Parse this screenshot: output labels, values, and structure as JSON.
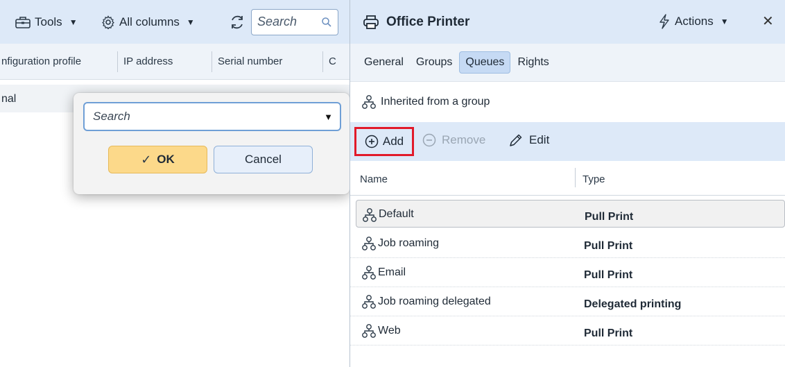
{
  "left": {
    "toolbar": {
      "tools_label": "Tools",
      "columns_label": "All columns",
      "search_placeholder": "Search"
    },
    "columns": [
      "nfiguration profile",
      "IP address",
      "Serial number",
      "C"
    ],
    "row_text": "nal"
  },
  "dialog": {
    "search_placeholder": "Search",
    "ok_label": "OK",
    "cancel_label": "Cancel"
  },
  "right": {
    "title": "Office Printer",
    "actions_label": "Actions",
    "tabs": [
      "General",
      "Groups",
      "Queues",
      "Rights"
    ],
    "active_tab": "Queues",
    "inherited_label": "Inherited from a group",
    "toolbar": {
      "add_label": "Add",
      "remove_label": "Remove",
      "edit_label": "Edit"
    },
    "grid": {
      "headers": [
        "Name",
        "Type"
      ],
      "rows": [
        {
          "name": "Default",
          "type": "Pull Print"
        },
        {
          "name": "Job roaming",
          "type": "Pull Print"
        },
        {
          "name": "Email",
          "type": "Pull Print"
        },
        {
          "name": "Job roaming delegated",
          "type": "Delegated printing"
        },
        {
          "name": "Web",
          "type": "Pull Print"
        }
      ]
    }
  },
  "colors": {
    "toolbar_bg": "#dde9f8",
    "header_bg": "#eef3f9",
    "ok_bg": "#fcd98a",
    "highlight": "#e11a2a",
    "active_tab": "#c6daf4"
  }
}
